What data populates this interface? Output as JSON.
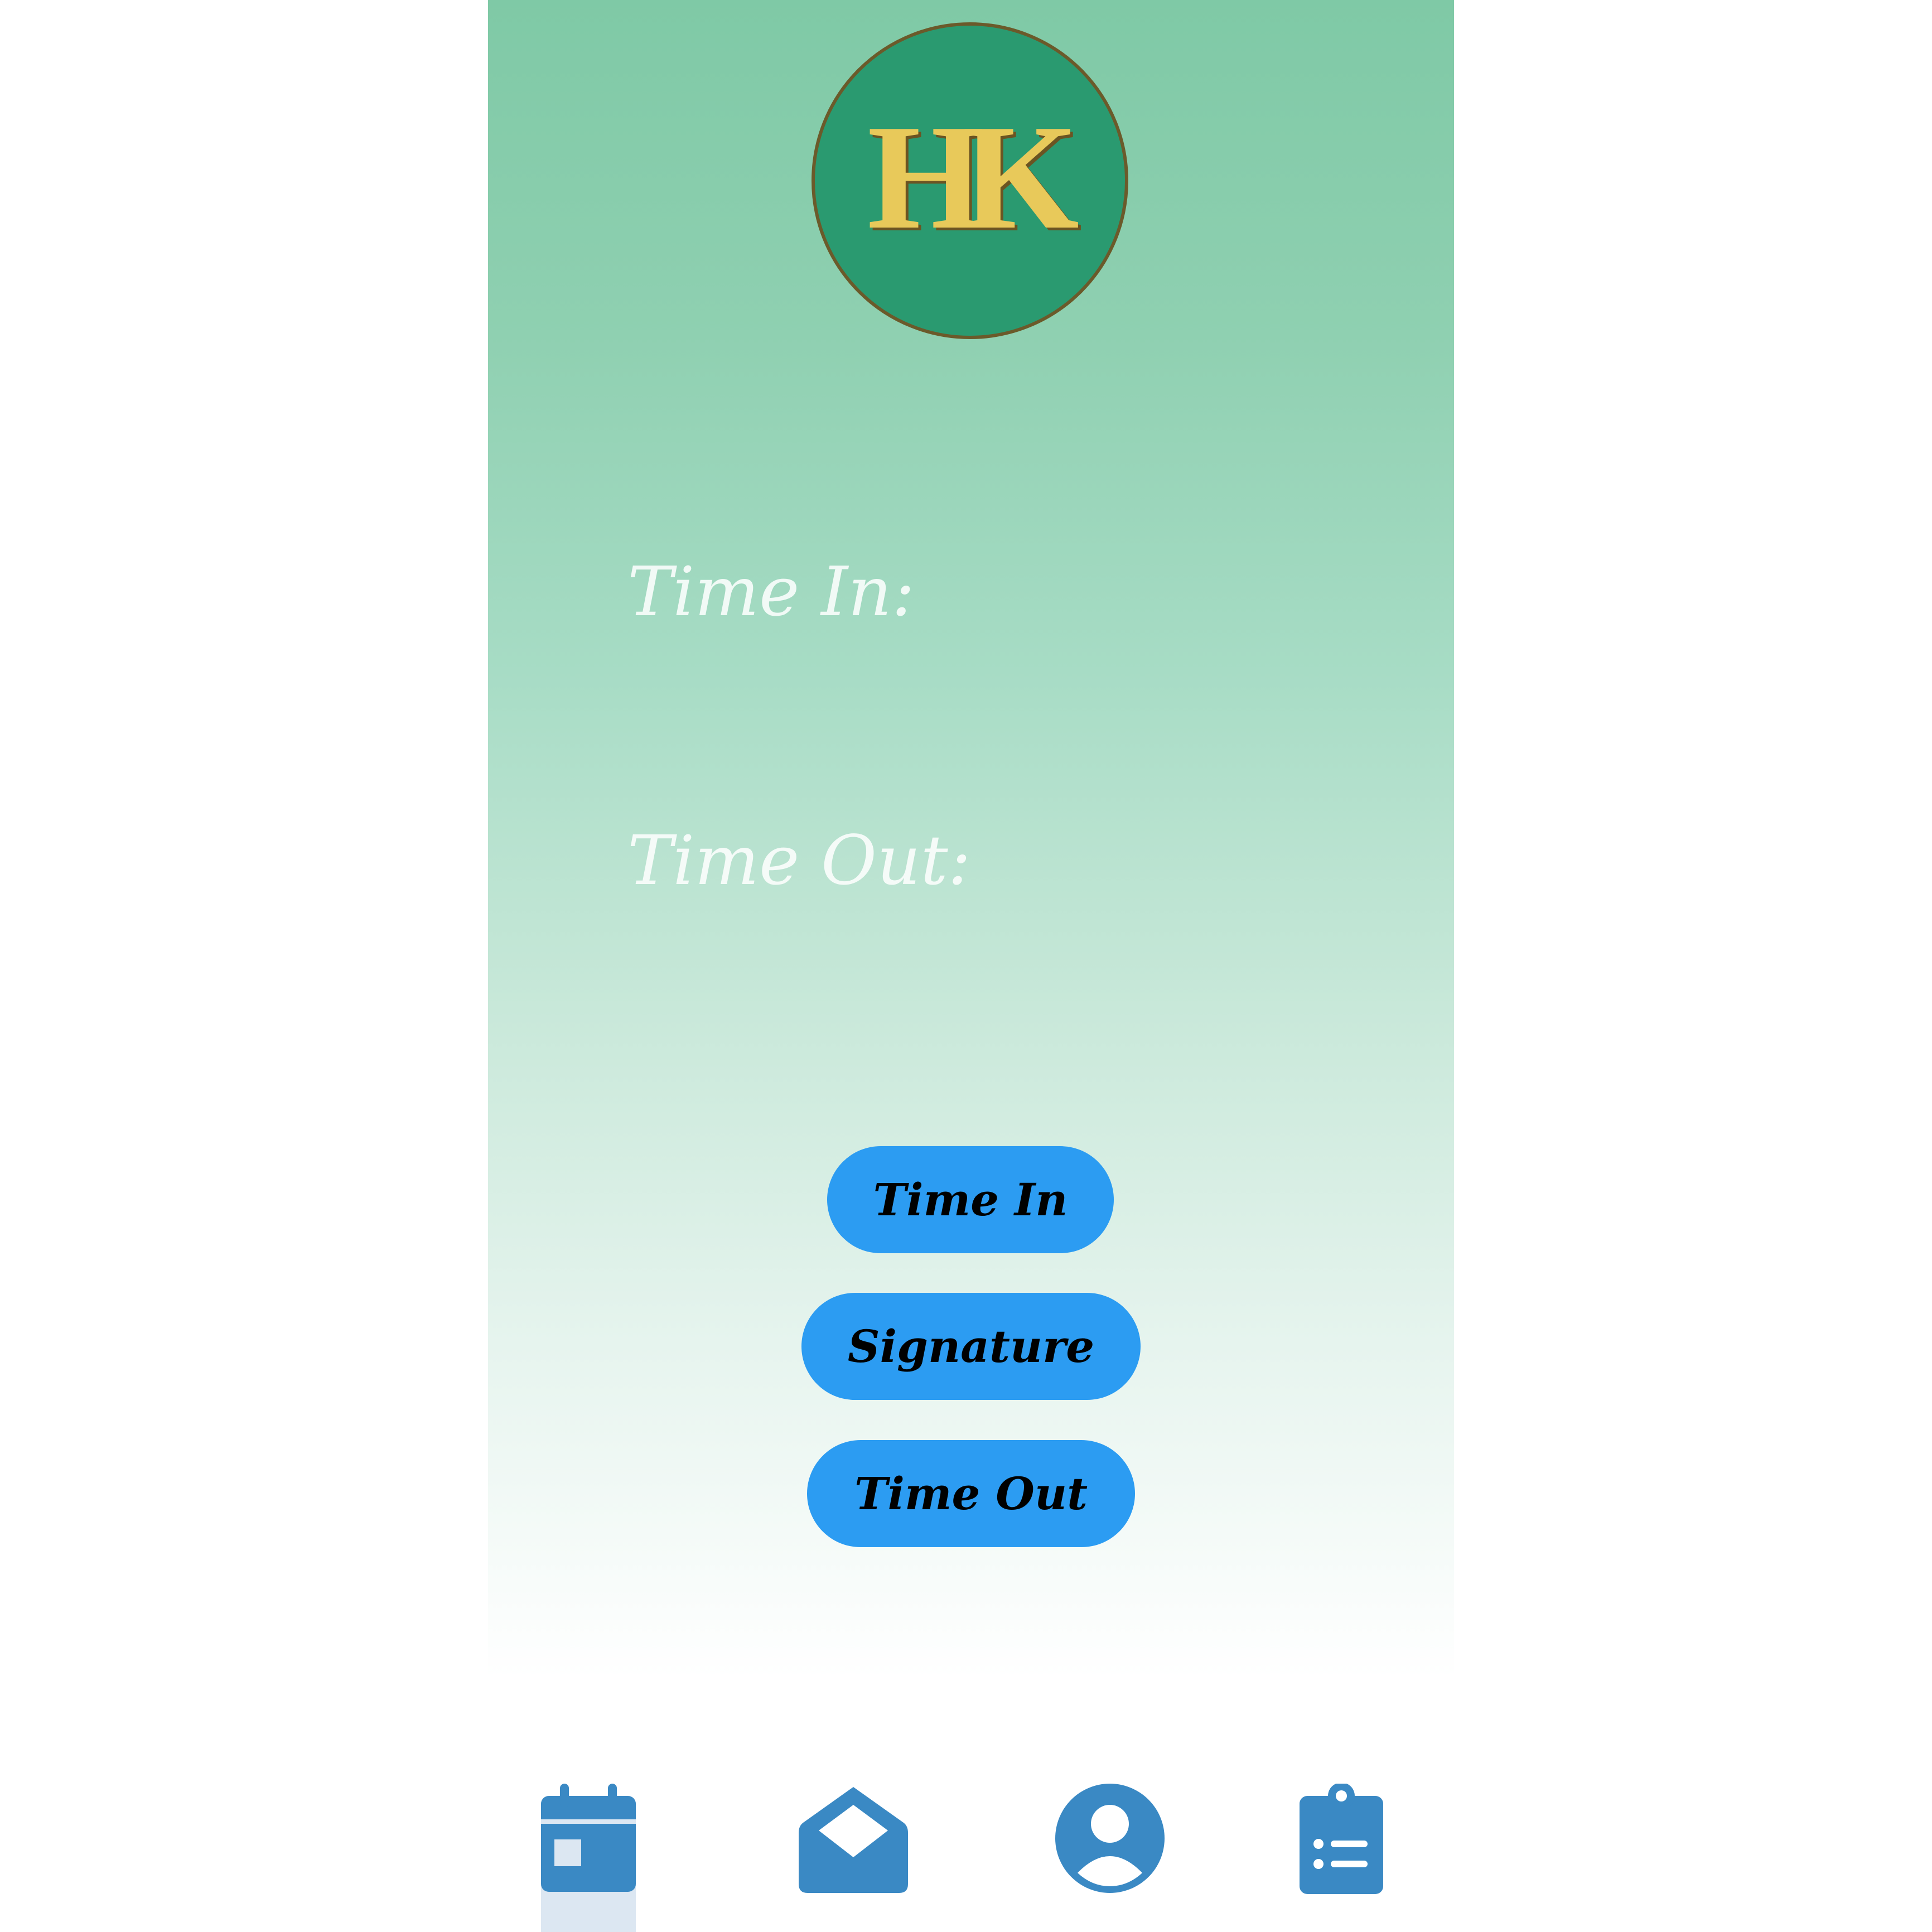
{
  "logo": {
    "text": "HK"
  },
  "fields": {
    "time_in_label": "Time In:",
    "time_out_label": "Time Out:"
  },
  "buttons": {
    "time_in": "Time In",
    "signature": "Signature",
    "time_out": "Time Out"
  },
  "nav": {
    "items": [
      {
        "icon": "calendar-icon",
        "active": true
      },
      {
        "icon": "mail-open-icon",
        "active": false
      },
      {
        "icon": "user-circle-icon",
        "active": false
      },
      {
        "icon": "clipboard-list-icon",
        "active": false
      }
    ]
  },
  "colors": {
    "accent_button": "#2c9cf2",
    "nav_icon": "#3a89c4",
    "logo_bg": "#2a9a70",
    "logo_text": "#e8c95a",
    "gradient_top": "#7fc9a6"
  }
}
